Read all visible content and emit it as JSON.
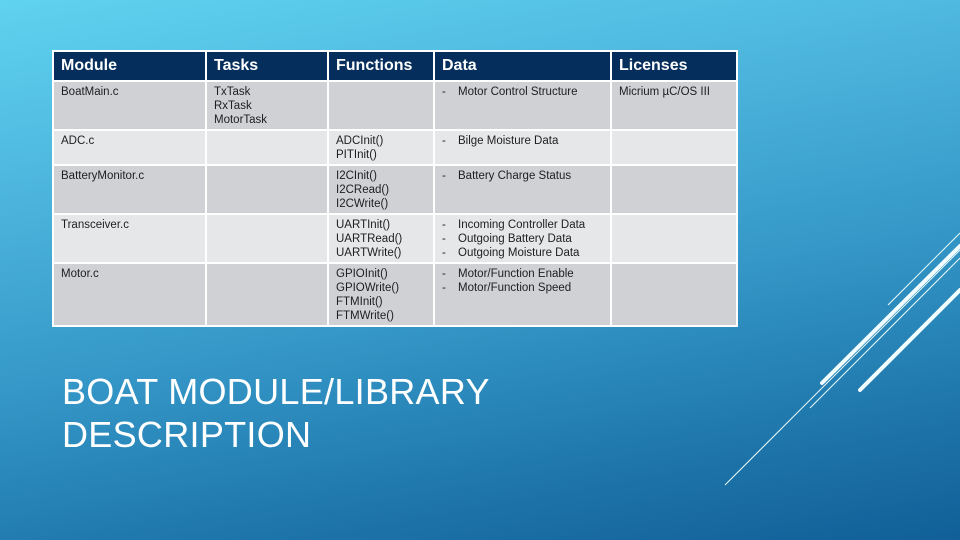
{
  "slide": {
    "title_line1": "BOAT MODULE/LIBRARY",
    "title_line2": "DESCRIPTION"
  },
  "table": {
    "headers": [
      "Module",
      "Tasks",
      "Functions",
      "Data",
      "Licenses"
    ],
    "rows": [
      {
        "module": "BoatMain.c",
        "tasks": [
          "TxTask",
          "RxTask",
          "MotorTask"
        ],
        "functions": [],
        "data": [
          "Motor Control Structure"
        ],
        "licenses": "Micrium µC/OS III"
      },
      {
        "module": "ADC.c",
        "tasks": [],
        "functions": [
          "ADCInit()",
          "PITInit()"
        ],
        "data": [
          "Bilge Moisture Data"
        ],
        "licenses": ""
      },
      {
        "module": "BatteryMonitor.c",
        "tasks": [],
        "functions": [
          "I2CInit()",
          "I2CRead()",
          "I2CWrite()"
        ],
        "data": [
          "Battery Charge Status"
        ],
        "licenses": ""
      },
      {
        "module": "Transceiver.c",
        "tasks": [],
        "functions": [
          "UARTInit()",
          "UARTRead()",
          "UARTWrite()"
        ],
        "data": [
          "Incoming Controller Data",
          "Outgoing Battery Data",
          "Outgoing Moisture Data"
        ],
        "licenses": ""
      },
      {
        "module": "Motor.c",
        "tasks": [],
        "functions": [
          "GPIOInit()",
          "GPIOWrite()",
          "FTMInit()",
          "FTMWrite()"
        ],
        "data": [
          "Motor/Function Enable",
          "Motor/Function Speed"
        ],
        "licenses": ""
      }
    ],
    "bullet_char": "-"
  },
  "colors": {
    "header_bg": "#062e5c",
    "row_odd": "#cfd1d5",
    "row_even": "#e6e7e9",
    "background_top": "#5fd3ef",
    "background_bottom": "#115f98"
  }
}
